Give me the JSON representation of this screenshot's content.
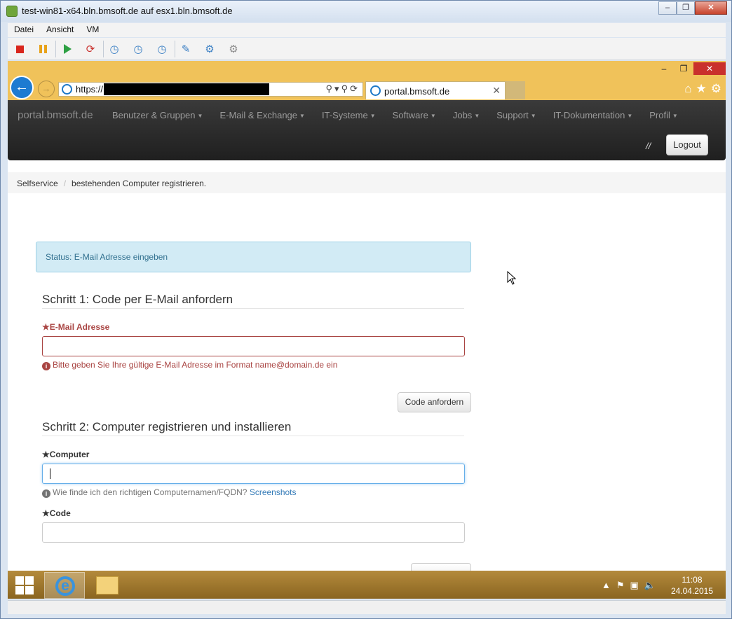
{
  "vm": {
    "title": "test-win81-x64.bln.bmsoft.de auf esx1.bln.bmsoft.de",
    "menu": [
      "Datei",
      "Ansicht",
      "VM"
    ]
  },
  "browser": {
    "url_prefix": "https://",
    "tab_title": "portal.bmsoft.de"
  },
  "navbar": {
    "brand": "portal.bmsoft.de",
    "items": [
      "Benutzer & Gruppen",
      "E-Mail & Exchange",
      "IT-Systeme",
      "Software",
      "Jobs",
      "Support",
      "IT-Dokumentation",
      "Profil"
    ],
    "slashes": "//",
    "logout": "Logout"
  },
  "breadcrumb": {
    "root": "Selfservice",
    "current": "bestehenden Computer registrieren."
  },
  "status": "Status: E-Mail Adresse eingeben",
  "step1": {
    "title": "Schritt 1: Code per E-Mail anfordern",
    "email_label": "E-Mail Adresse",
    "email_value": "",
    "email_error": "Bitte geben Sie Ihre gültige E-Mail Adresse im Format name@domain.de ein",
    "button": "Code anfordern"
  },
  "step2": {
    "title": "Schritt 2: Computer registrieren und installieren",
    "computer_label": "Computer",
    "computer_value": "",
    "computer_help": "Wie finde ich den richtigen Computernamen/FQDN?",
    "computer_help_link": "Screenshots",
    "code_label": "Code",
    "code_value": ""
  },
  "required_marker": "★",
  "taskbar": {
    "time": "11:08",
    "date": "24.04.2015"
  }
}
